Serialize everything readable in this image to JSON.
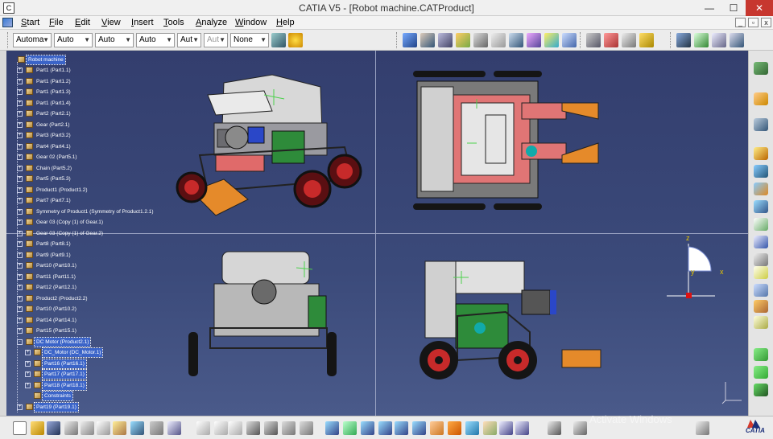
{
  "window": {
    "app_icon": "catia-app-icon",
    "title": "CATIA V5 - [Robot machine.CATProduct]",
    "min_label": "—",
    "max_label": "☐",
    "close_label": "✕"
  },
  "menu": {
    "items": [
      "Start",
      "File",
      "Edit",
      "View",
      "Insert",
      "Tools",
      "Analyze",
      "Window",
      "Help"
    ],
    "doc_min": "_",
    "doc_restore": "▫",
    "doc_close": "x"
  },
  "toolbar": {
    "combos": [
      {
        "value": "Automa",
        "enabled": true
      },
      {
        "value": "Auto",
        "enabled": true
      },
      {
        "value": "Auto",
        "enabled": true
      },
      {
        "value": "Auto",
        "enabled": true
      },
      {
        "value": "Aut",
        "enabled": true
      },
      {
        "value": "Aut",
        "enabled": false
      },
      {
        "value": "None",
        "enabled": true
      }
    ]
  },
  "tree": {
    "root": "Robot machine",
    "nodes": [
      "Part1 (Part1.1)",
      "Part1 (Part1.2)",
      "Part1 (Part1.3)",
      "Part1 (Part1.4)",
      "Part2 (Part2.1)",
      "Gear (Part2.1)",
      "Part3 (Part3.2)",
      "Part4 (Part4.1)",
      "Gear 02 (Part5.1)",
      "Chain (Part5.2)",
      "Part5 (Part5.3)",
      "Product1 (Product1.2)",
      "Part7 (Part7.1)",
      "Symmetry of Product1 (Symmetry of Product1.2.1)",
      "Gear 03 (Copy (1) of Gear.1)",
      "Gear 03 (Copy (1) of Gear.2)",
      "Part8 (Part8.1)",
      "Part9 (Part9.1)",
      "Part10 (Part10.1)",
      "Part11 (Part11.1)",
      "Part12 (Part12.1)",
      "Product2 (Product2.2)",
      "Part10 (Part10.2)",
      "Part14 (Part14.1)",
      "Part15 (Part15.1)",
      "DC Motor (Product2.1)",
      "DC_Motor (DC_Motor.1)",
      "Part16 (Part16.1)",
      "Part17 (Part17.1)",
      "Part18 (Part18.1)",
      "Constraints",
      "Part19 (Part19.1)"
    ]
  },
  "compass": {
    "x_label": "x",
    "y_label": "y",
    "z_label": "z"
  },
  "watermark": "Activate Windows",
  "logo": "CATIA",
  "colors": {
    "viewport_bg": "#333e6e",
    "selection": "#3b64c8",
    "compass": "#e6c400"
  }
}
